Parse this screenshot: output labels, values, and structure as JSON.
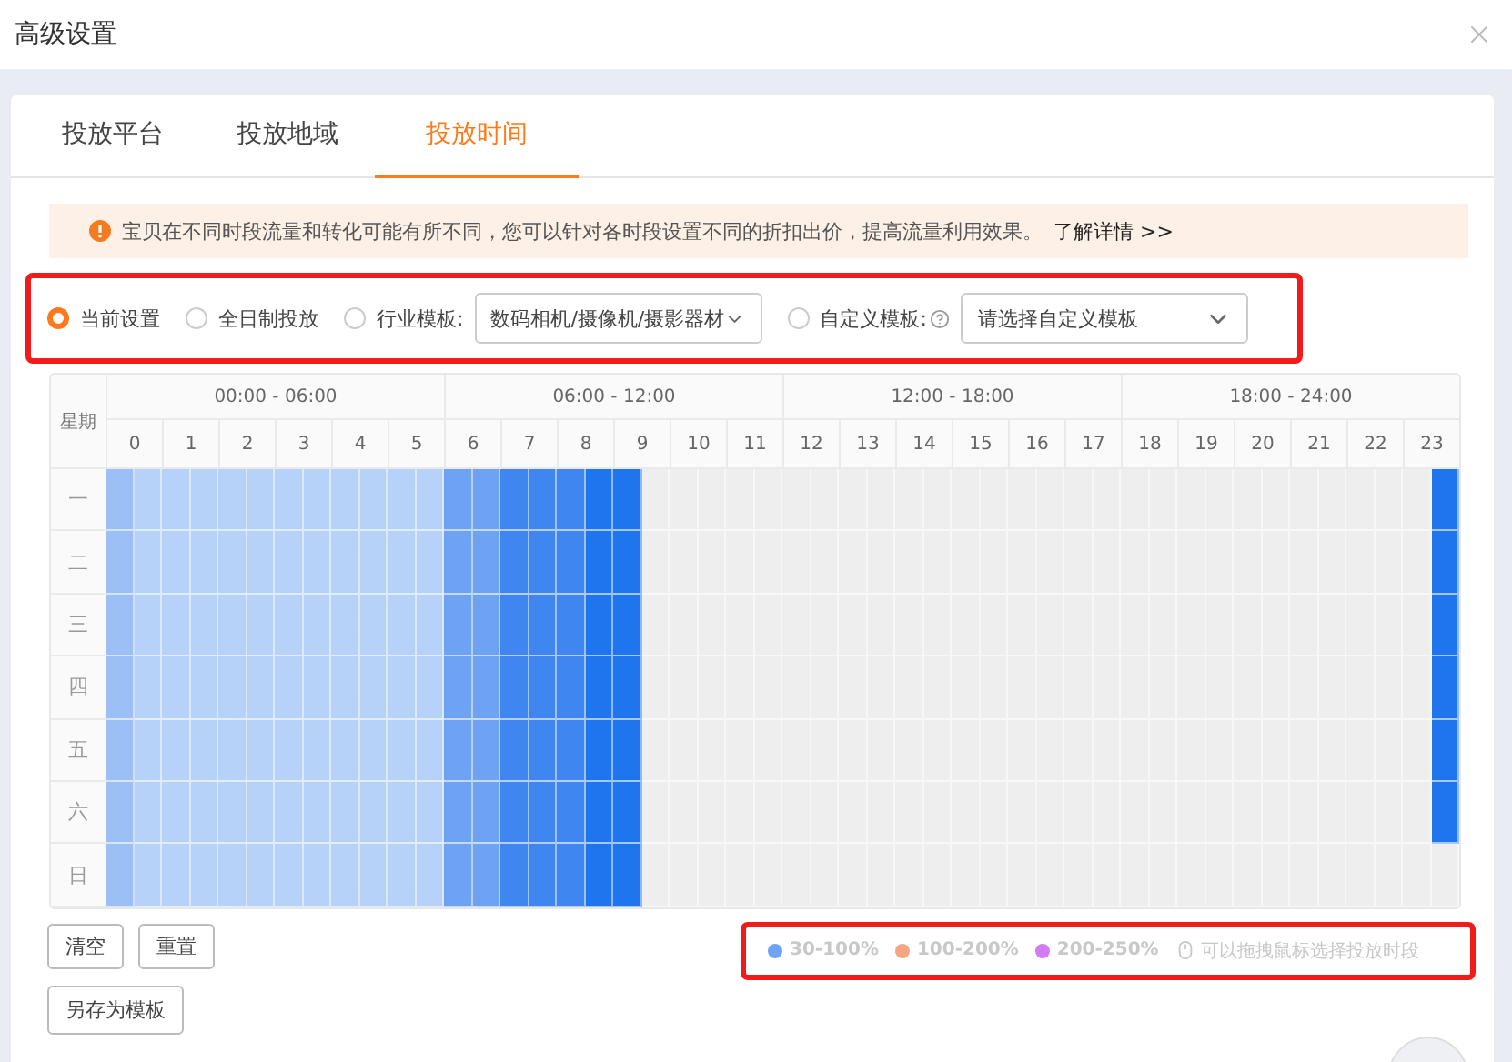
{
  "window": {
    "title": "高级设置"
  },
  "tabs": [
    {
      "label": "投放平台",
      "selected": false
    },
    {
      "label": "投放地域",
      "selected": false
    },
    {
      "label": "投放时间",
      "selected": true
    }
  ],
  "notice": {
    "text": "宝贝在不同时段流量和转化可能有所不同，您可以针对各时段设置不同的折扣出价，提高流量利用效果。",
    "link": "了解详情 >>"
  },
  "options": [
    {
      "kind": "radio",
      "label": "当前设置",
      "selected": true
    },
    {
      "kind": "radio",
      "label": "全日制投放",
      "selected": false
    },
    {
      "kind": "select",
      "label": "行业模板:",
      "selected": false,
      "value": "数码相机/摄像机/摄影器材"
    },
    {
      "kind": "select",
      "label": "自定义模板:",
      "help": true,
      "selected": false,
      "placeholder": "请选择自定义模板"
    }
  ],
  "schedule": {
    "corner": "星期",
    "periods": [
      "00:00 - 06:00",
      "06:00 - 12:00",
      "12:00 - 18:00",
      "18:00 - 24:00"
    ],
    "hours": [
      "0",
      "1",
      "2",
      "3",
      "4",
      "5",
      "6",
      "7",
      "8",
      "9",
      "10",
      "11",
      "12",
      "13",
      "14",
      "15",
      "16",
      "17",
      "18",
      "19",
      "20",
      "21",
      "22",
      "23"
    ],
    "rows": [
      {
        "day": "一",
        "cells": [
          {
            "color": "#9cc0f6"
          },
          {
            "color": "#b6d2f9"
          },
          {
            "color": "#b6d2f9"
          },
          {
            "color": "#b6d2f9"
          },
          {
            "color": "#b6d2f9"
          },
          {
            "color": "#b6d2f9"
          },
          {
            "color": "#b6d2f9"
          },
          {
            "color": "#b6d2f9"
          },
          {
            "color": "#b6d2f9"
          },
          {
            "color": "#b6d2f9"
          },
          {
            "color": "#b6d2f9"
          },
          {
            "color": "#b6d2f9"
          },
          {
            "color": "#6ea3f4"
          },
          {
            "color": "#6ea3f4"
          },
          {
            "color": "#3f86f0"
          },
          {
            "color": "#3f86f0"
          },
          {
            "color": "#3f86f0"
          },
          {
            "color": "#1f75ee"
          },
          {
            "color": "#1f75ee"
          },
          {
            "color": "#eeeeee"
          },
          {
            "color": "#eeeeee"
          },
          {
            "color": "#eeeeee"
          },
          {
            "color": "#eeeeee"
          },
          {
            "color": "#eeeeee"
          },
          {
            "color": "#eeeeee"
          },
          {
            "color": "#eeeeee"
          },
          {
            "color": "#eeeeee"
          },
          {
            "color": "#eeeeee"
          },
          {
            "color": "#eeeeee"
          },
          {
            "color": "#eeeeee"
          },
          {
            "color": "#eeeeee"
          },
          {
            "color": "#eeeeee"
          },
          {
            "color": "#eeeeee"
          },
          {
            "color": "#eeeeee"
          },
          {
            "color": "#eeeeee"
          },
          {
            "color": "#eeeeee"
          },
          {
            "color": "#eeeeee"
          },
          {
            "color": "#eeeeee"
          },
          {
            "color": "#eeeeee"
          },
          {
            "color": "#eeeeee"
          },
          {
            "color": "#eeeeee"
          },
          {
            "color": "#eeeeee"
          },
          {
            "color": "#eeeeee"
          },
          {
            "color": "#eeeeee"
          },
          {
            "color": "#eeeeee"
          },
          {
            "color": "#eeeeee"
          },
          {
            "color": "#eeeeee"
          },
          {
            "color": "#1f75ee"
          }
        ]
      },
      {
        "day": "二",
        "cells": [
          {
            "color": "#9cc0f6"
          },
          {
            "color": "#b6d2f9"
          },
          {
            "color": "#b6d2f9"
          },
          {
            "color": "#b6d2f9"
          },
          {
            "color": "#b6d2f9"
          },
          {
            "color": "#b6d2f9"
          },
          {
            "color": "#b6d2f9"
          },
          {
            "color": "#b6d2f9"
          },
          {
            "color": "#b6d2f9"
          },
          {
            "color": "#b6d2f9"
          },
          {
            "color": "#b6d2f9"
          },
          {
            "color": "#b6d2f9"
          },
          {
            "color": "#6ea3f4"
          },
          {
            "color": "#6ea3f4"
          },
          {
            "color": "#3f86f0"
          },
          {
            "color": "#3f86f0"
          },
          {
            "color": "#3f86f0"
          },
          {
            "color": "#1f75ee"
          },
          {
            "color": "#1f75ee"
          },
          {
            "color": "#eeeeee"
          },
          {
            "color": "#eeeeee"
          },
          {
            "color": "#eeeeee"
          },
          {
            "color": "#eeeeee"
          },
          {
            "color": "#eeeeee"
          },
          {
            "color": "#eeeeee"
          },
          {
            "color": "#eeeeee"
          },
          {
            "color": "#eeeeee"
          },
          {
            "color": "#eeeeee"
          },
          {
            "color": "#eeeeee"
          },
          {
            "color": "#eeeeee"
          },
          {
            "color": "#eeeeee"
          },
          {
            "color": "#eeeeee"
          },
          {
            "color": "#eeeeee"
          },
          {
            "color": "#eeeeee"
          },
          {
            "color": "#eeeeee"
          },
          {
            "color": "#eeeeee"
          },
          {
            "color": "#eeeeee"
          },
          {
            "color": "#eeeeee"
          },
          {
            "color": "#eeeeee"
          },
          {
            "color": "#eeeeee"
          },
          {
            "color": "#eeeeee"
          },
          {
            "color": "#eeeeee"
          },
          {
            "color": "#eeeeee"
          },
          {
            "color": "#eeeeee"
          },
          {
            "color": "#eeeeee"
          },
          {
            "color": "#eeeeee"
          },
          {
            "color": "#eeeeee"
          },
          {
            "color": "#1f75ee"
          }
        ]
      },
      {
        "day": "三",
        "cells": [
          {
            "color": "#9cc0f6"
          },
          {
            "color": "#b6d2f9"
          },
          {
            "color": "#b6d2f9"
          },
          {
            "color": "#b6d2f9"
          },
          {
            "color": "#b6d2f9"
          },
          {
            "color": "#b6d2f9"
          },
          {
            "color": "#b6d2f9"
          },
          {
            "color": "#b6d2f9"
          },
          {
            "color": "#b6d2f9"
          },
          {
            "color": "#b6d2f9"
          },
          {
            "color": "#b6d2f9"
          },
          {
            "color": "#b6d2f9"
          },
          {
            "color": "#6ea3f4"
          },
          {
            "color": "#6ea3f4"
          },
          {
            "color": "#3f86f0"
          },
          {
            "color": "#3f86f0"
          },
          {
            "color": "#3f86f0"
          },
          {
            "color": "#1f75ee"
          },
          {
            "color": "#1f75ee"
          },
          {
            "color": "#eeeeee"
          },
          {
            "color": "#eeeeee"
          },
          {
            "color": "#eeeeee"
          },
          {
            "color": "#eeeeee"
          },
          {
            "color": "#eeeeee"
          },
          {
            "color": "#eeeeee"
          },
          {
            "color": "#eeeeee"
          },
          {
            "color": "#eeeeee"
          },
          {
            "color": "#eeeeee"
          },
          {
            "color": "#eeeeee"
          },
          {
            "color": "#eeeeee"
          },
          {
            "color": "#eeeeee"
          },
          {
            "color": "#eeeeee"
          },
          {
            "color": "#eeeeee"
          },
          {
            "color": "#eeeeee"
          },
          {
            "color": "#eeeeee"
          },
          {
            "color": "#eeeeee"
          },
          {
            "color": "#eeeeee"
          },
          {
            "color": "#eeeeee"
          },
          {
            "color": "#eeeeee"
          },
          {
            "color": "#eeeeee"
          },
          {
            "color": "#eeeeee"
          },
          {
            "color": "#eeeeee"
          },
          {
            "color": "#eeeeee"
          },
          {
            "color": "#eeeeee"
          },
          {
            "color": "#eeeeee"
          },
          {
            "color": "#eeeeee"
          },
          {
            "color": "#eeeeee"
          },
          {
            "color": "#1f75ee"
          }
        ]
      },
      {
        "day": "四",
        "cells": [
          {
            "color": "#9cc0f6"
          },
          {
            "color": "#b6d2f9"
          },
          {
            "color": "#b6d2f9"
          },
          {
            "color": "#b6d2f9"
          },
          {
            "color": "#b6d2f9"
          },
          {
            "color": "#b6d2f9"
          },
          {
            "color": "#b6d2f9"
          },
          {
            "color": "#b6d2f9"
          },
          {
            "color": "#b6d2f9"
          },
          {
            "color": "#b6d2f9"
          },
          {
            "color": "#b6d2f9"
          },
          {
            "color": "#b6d2f9"
          },
          {
            "color": "#6ea3f4"
          },
          {
            "color": "#6ea3f4"
          },
          {
            "color": "#3f86f0"
          },
          {
            "color": "#3f86f0"
          },
          {
            "color": "#3f86f0"
          },
          {
            "color": "#1f75ee"
          },
          {
            "color": "#1f75ee"
          },
          {
            "color": "#eeeeee"
          },
          {
            "color": "#eeeeee"
          },
          {
            "color": "#eeeeee"
          },
          {
            "color": "#eeeeee"
          },
          {
            "color": "#eeeeee"
          },
          {
            "color": "#eeeeee"
          },
          {
            "color": "#eeeeee"
          },
          {
            "color": "#eeeeee"
          },
          {
            "color": "#eeeeee"
          },
          {
            "color": "#eeeeee"
          },
          {
            "color": "#eeeeee"
          },
          {
            "color": "#eeeeee"
          },
          {
            "color": "#eeeeee"
          },
          {
            "color": "#eeeeee"
          },
          {
            "color": "#eeeeee"
          },
          {
            "color": "#eeeeee"
          },
          {
            "color": "#eeeeee"
          },
          {
            "color": "#eeeeee"
          },
          {
            "color": "#eeeeee"
          },
          {
            "color": "#eeeeee"
          },
          {
            "color": "#eeeeee"
          },
          {
            "color": "#eeeeee"
          },
          {
            "color": "#eeeeee"
          },
          {
            "color": "#eeeeee"
          },
          {
            "color": "#eeeeee"
          },
          {
            "color": "#eeeeee"
          },
          {
            "color": "#eeeeee"
          },
          {
            "color": "#eeeeee"
          },
          {
            "color": "#1f75ee"
          }
        ]
      },
      {
        "day": "五",
        "cells": [
          {
            "color": "#9cc0f6"
          },
          {
            "color": "#b6d2f9"
          },
          {
            "color": "#b6d2f9"
          },
          {
            "color": "#b6d2f9"
          },
          {
            "color": "#b6d2f9"
          },
          {
            "color": "#b6d2f9"
          },
          {
            "color": "#b6d2f9"
          },
          {
            "color": "#b6d2f9"
          },
          {
            "color": "#b6d2f9"
          },
          {
            "color": "#b6d2f9"
          },
          {
            "color": "#b6d2f9"
          },
          {
            "color": "#b6d2f9"
          },
          {
            "color": "#6ea3f4"
          },
          {
            "color": "#6ea3f4"
          },
          {
            "color": "#3f86f0"
          },
          {
            "color": "#3f86f0"
          },
          {
            "color": "#3f86f0"
          },
          {
            "color": "#1f75ee"
          },
          {
            "color": "#1f75ee"
          },
          {
            "color": "#eeeeee"
          },
          {
            "color": "#eeeeee"
          },
          {
            "color": "#eeeeee"
          },
          {
            "color": "#eeeeee"
          },
          {
            "color": "#eeeeee"
          },
          {
            "color": "#eeeeee"
          },
          {
            "color": "#eeeeee"
          },
          {
            "color": "#eeeeee"
          },
          {
            "color": "#eeeeee"
          },
          {
            "color": "#eeeeee"
          },
          {
            "color": "#eeeeee"
          },
          {
            "color": "#eeeeee"
          },
          {
            "color": "#eeeeee"
          },
          {
            "color": "#eeeeee"
          },
          {
            "color": "#eeeeee"
          },
          {
            "color": "#eeeeee"
          },
          {
            "color": "#eeeeee"
          },
          {
            "color": "#eeeeee"
          },
          {
            "color": "#eeeeee"
          },
          {
            "color": "#eeeeee"
          },
          {
            "color": "#eeeeee"
          },
          {
            "color": "#eeeeee"
          },
          {
            "color": "#eeeeee"
          },
          {
            "color": "#eeeeee"
          },
          {
            "color": "#eeeeee"
          },
          {
            "color": "#eeeeee"
          },
          {
            "color": "#eeeeee"
          },
          {
            "color": "#eeeeee"
          },
          {
            "color": "#1f75ee"
          }
        ]
      },
      {
        "day": "六",
        "cells": [
          {
            "color": "#9cc0f6"
          },
          {
            "color": "#b6d2f9"
          },
          {
            "color": "#b6d2f9"
          },
          {
            "color": "#b6d2f9"
          },
          {
            "color": "#b6d2f9"
          },
          {
            "color": "#b6d2f9"
          },
          {
            "color": "#b6d2f9"
          },
          {
            "color": "#b6d2f9"
          },
          {
            "color": "#b6d2f9"
          },
          {
            "color": "#b6d2f9"
          },
          {
            "color": "#b6d2f9"
          },
          {
            "color": "#b6d2f9"
          },
          {
            "color": "#6ea3f4"
          },
          {
            "color": "#6ea3f4"
          },
          {
            "color": "#3f86f0"
          },
          {
            "color": "#3f86f0"
          },
          {
            "color": "#3f86f0"
          },
          {
            "color": "#1f75ee"
          },
          {
            "color": "#1f75ee"
          },
          {
            "color": "#eeeeee"
          },
          {
            "color": "#eeeeee"
          },
          {
            "color": "#eeeeee"
          },
          {
            "color": "#eeeeee"
          },
          {
            "color": "#eeeeee"
          },
          {
            "color": "#eeeeee"
          },
          {
            "color": "#eeeeee"
          },
          {
            "color": "#eeeeee"
          },
          {
            "color": "#eeeeee"
          },
          {
            "color": "#eeeeee"
          },
          {
            "color": "#eeeeee"
          },
          {
            "color": "#eeeeee"
          },
          {
            "color": "#eeeeee"
          },
          {
            "color": "#eeeeee"
          },
          {
            "color": "#eeeeee"
          },
          {
            "color": "#eeeeee"
          },
          {
            "color": "#eeeeee"
          },
          {
            "color": "#eeeeee"
          },
          {
            "color": "#eeeeee"
          },
          {
            "color": "#eeeeee"
          },
          {
            "color": "#eeeeee"
          },
          {
            "color": "#eeeeee"
          },
          {
            "color": "#eeeeee"
          },
          {
            "color": "#eeeeee"
          },
          {
            "color": "#eeeeee"
          },
          {
            "color": "#eeeeee"
          },
          {
            "color": "#eeeeee"
          },
          {
            "color": "#eeeeee"
          },
          {
            "color": "#1f75ee"
          }
        ]
      },
      {
        "day": "日",
        "cells": [
          {
            "color": "#9cc0f6"
          },
          {
            "color": "#b6d2f9"
          },
          {
            "color": "#b6d2f9"
          },
          {
            "color": "#b6d2f9"
          },
          {
            "color": "#b6d2f9"
          },
          {
            "color": "#b6d2f9"
          },
          {
            "color": "#b6d2f9"
          },
          {
            "color": "#b6d2f9"
          },
          {
            "color": "#b6d2f9"
          },
          {
            "color": "#b6d2f9"
          },
          {
            "color": "#b6d2f9"
          },
          {
            "color": "#b6d2f9"
          },
          {
            "color": "#6ea3f4"
          },
          {
            "color": "#6ea3f4"
          },
          {
            "color": "#3f86f0"
          },
          {
            "color": "#3f86f0"
          },
          {
            "color": "#3f86f0"
          },
          {
            "color": "#1f75ee"
          },
          {
            "color": "#1f75ee"
          },
          {
            "color": "#eeeeee"
          },
          {
            "color": "#eeeeee"
          },
          {
            "color": "#eeeeee"
          },
          {
            "color": "#eeeeee"
          },
          {
            "color": "#eeeeee"
          },
          {
            "color": "#eeeeee"
          },
          {
            "color": "#eeeeee"
          },
          {
            "color": "#eeeeee"
          },
          {
            "color": "#eeeeee"
          },
          {
            "color": "#eeeeee"
          },
          {
            "color": "#eeeeee"
          },
          {
            "color": "#eeeeee"
          },
          {
            "color": "#eeeeee"
          },
          {
            "color": "#eeeeee"
          },
          {
            "color": "#eeeeee"
          },
          {
            "color": "#eeeeee"
          },
          {
            "color": "#eeeeee"
          },
          {
            "color": "#eeeeee"
          },
          {
            "color": "#eeeeee"
          },
          {
            "color": "#eeeeee"
          },
          {
            "color": "#eeeeee"
          },
          {
            "color": "#eeeeee"
          },
          {
            "color": "#eeeeee"
          },
          {
            "color": "#eeeeee"
          },
          {
            "color": "#eeeeee"
          },
          {
            "color": "#eeeeee"
          },
          {
            "color": "#eeeeee"
          },
          {
            "color": "#eeeeee"
          },
          {
            "color": "#eeeeee"
          }
        ]
      }
    ]
  },
  "buttons": [
    "清空",
    "重置"
  ],
  "save_button": "另存为模板",
  "legend": [
    {
      "label": "30-100%",
      "color": "#6fa3f5"
    },
    {
      "label": "100-200%",
      "color": "#f5a582"
    },
    {
      "label": "200-250%",
      "color": "#d27bf2"
    }
  ],
  "hint": "可以拖拽鼠标选择投放时段"
}
